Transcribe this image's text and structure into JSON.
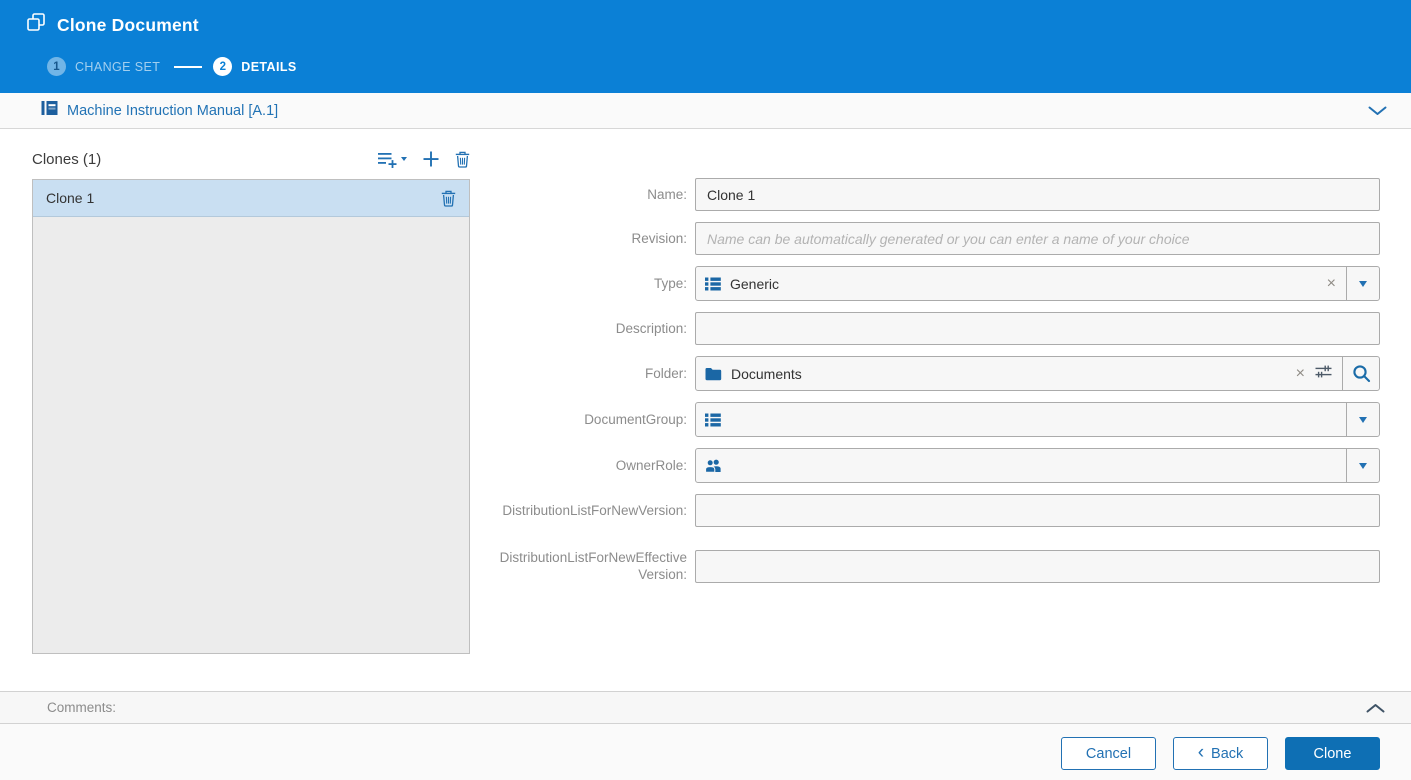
{
  "window": {
    "title": "Clone Document"
  },
  "stepper": {
    "step1": {
      "number": "1",
      "label": "CHANGE SET"
    },
    "step2": {
      "number": "2",
      "label": "DETAILS"
    }
  },
  "document_bar": {
    "title": "Machine Instruction Manual [A.1]"
  },
  "clones_panel": {
    "title": "Clones (1)",
    "items": [
      {
        "name": "Clone 1"
      }
    ]
  },
  "form": {
    "name": {
      "label": "Name:",
      "value": "Clone 1"
    },
    "revision": {
      "label": "Revision:",
      "value": "",
      "placeholder": "Name can be automatically generated or you can enter a name of your choice"
    },
    "type": {
      "label": "Type:",
      "value": "Generic"
    },
    "description": {
      "label": "Description:",
      "value": ""
    },
    "folder": {
      "label": "Folder:",
      "value": "Documents"
    },
    "document_group": {
      "label": "DocumentGroup:",
      "value": ""
    },
    "owner_role": {
      "label": "OwnerRole:",
      "value": ""
    },
    "dist_new_version": {
      "label": "DistributionListForNewVersion:",
      "value": ""
    },
    "dist_new_effective_version": {
      "label": "DistributionListForNewEffectiveVersion:",
      "value": ""
    }
  },
  "comments": {
    "label": "Comments:"
  },
  "footer": {
    "cancel": "Cancel",
    "back": "Back",
    "clone": "Clone"
  },
  "colors": {
    "header_blue": "#0b80d6",
    "accent_blue": "#2271b3",
    "icon_blue": "#1b67a5",
    "primary_button_blue": "#0e6fb4",
    "selected_row_blue": "#c9dff2",
    "field_bg": "#f7f7f7"
  }
}
